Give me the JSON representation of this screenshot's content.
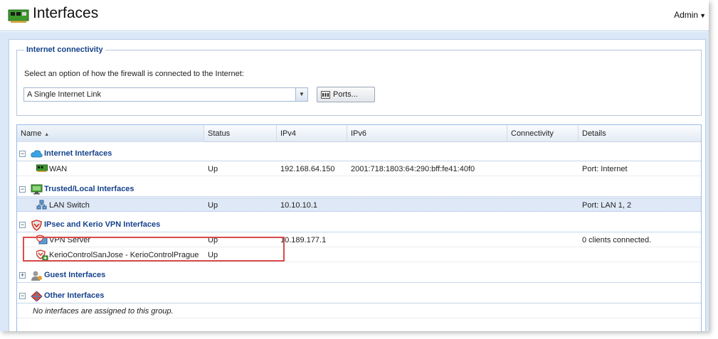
{
  "header": {
    "title": "Interfaces",
    "user_menu": "Admin",
    "app_icon": "network-card-icon"
  },
  "connectivity": {
    "legend": "Internet connectivity",
    "description": "Select an option of how the firewall is connected to the Internet:",
    "mode_value": "A Single Internet Link",
    "ports_button": "Ports..."
  },
  "grid": {
    "columns": [
      "Name",
      "Status",
      "IPv4",
      "IPv6",
      "Connectivity",
      "Details"
    ],
    "sorted_column": "Name",
    "groups": [
      {
        "label": "Internet Interfaces",
        "icon": "cloud-icon",
        "expanded": true,
        "rows": [
          {
            "name": "WAN",
            "status": "Up",
            "ipv4": "192.168.64.150",
            "ipv6": "2001:718:1803:64:290:bff:fe41:40f0",
            "connectivity": "",
            "details": "Port: Internet",
            "icon": "network-card-icon"
          }
        ]
      },
      {
        "label": "Trusted/Local Interfaces",
        "icon": "monitor-icon",
        "expanded": true,
        "rows": [
          {
            "name": "LAN Switch",
            "status": "Up",
            "ipv4": "10.10.10.1",
            "ipv6": "",
            "connectivity": "",
            "details": "Port: LAN 1, 2",
            "icon": "switch-icon"
          }
        ]
      },
      {
        "label": "IPsec and Kerio VPN Interfaces",
        "icon": "shield-icon",
        "expanded": true,
        "rows": [
          {
            "name": "VPN Server",
            "status": "Up",
            "ipv4": "10.189.177.1",
            "ipv6": "",
            "connectivity": "",
            "details": "0 clients connected.",
            "icon": "vpn-server-icon"
          },
          {
            "name": "KerioControlSanJose - KerioControlPrague",
            "status": "Up",
            "ipv4": "",
            "ipv6": "",
            "connectivity": "",
            "details": "",
            "icon": "vpn-tunnel-icon"
          }
        ]
      },
      {
        "label": "Guest Interfaces",
        "icon": "guest-user-icon",
        "expanded": false,
        "rows": []
      },
      {
        "label": "Other Interfaces",
        "icon": "diamond-icon",
        "expanded": true,
        "rows": [],
        "empty_text": "No interfaces are assigned to this group."
      }
    ]
  },
  "colors": {
    "group_label": "#15428b",
    "highlight": "#d94c4c",
    "selected_row": "#dfe8f6"
  }
}
